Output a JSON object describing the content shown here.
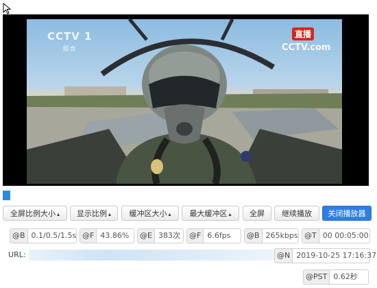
{
  "player": {
    "logo_left": "CCTV 1",
    "logo_left_sub": "综合",
    "live_badge": "直播",
    "logo_right": "CCTV.com"
  },
  "progress": {
    "fraction": 0.02,
    "color": "#2a8be0"
  },
  "controls": {
    "fullscreen_ratio": "全屏比例大小",
    "display_ratio": "显示比例",
    "buffer_size": "缓冲区大小",
    "max_buffer": "最大缓冲区",
    "fullscreen": "全屏",
    "continue_play": "继续播放",
    "close_player": "关闭播放器",
    "caret": "▴"
  },
  "stats": [
    {
      "key": "@B",
      "value": "0.1/0.5/1.5s"
    },
    {
      "key": "@F",
      "value": "43.86%"
    },
    {
      "key": "@E",
      "value": "383次"
    },
    {
      "key": "@F",
      "value": "6.6fps"
    },
    {
      "key": "@B",
      "value": "265kbps"
    },
    {
      "key": "@T",
      "value": "00 00:05:00"
    }
  ],
  "url": {
    "label": "URL:",
    "value": ""
  },
  "timestamp": {
    "key": "@N",
    "value": "2019-10-25 17:16:37"
  },
  "pst": {
    "key": "@PST",
    "value": "0.62秒"
  },
  "colors": {
    "accent": "#2f7fde",
    "live": "#d8261c"
  }
}
